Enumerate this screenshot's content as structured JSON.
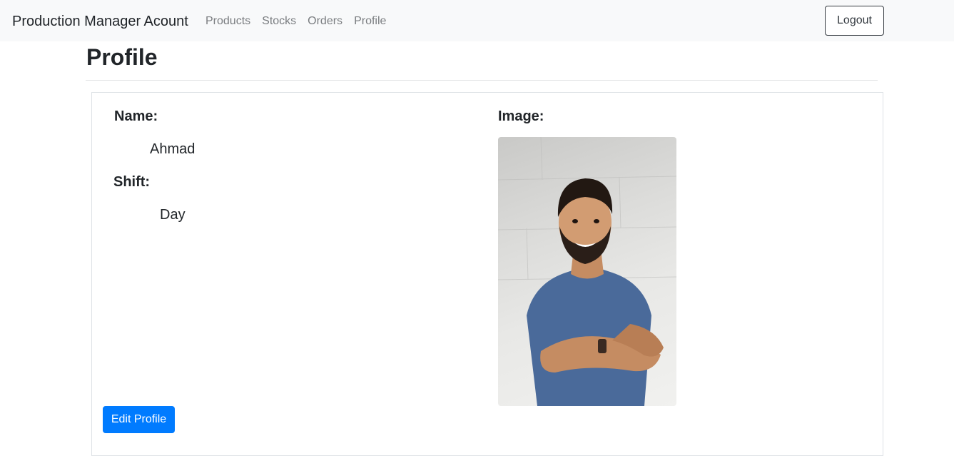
{
  "navbar": {
    "brand": "Production Manager Acount",
    "links": [
      "Products",
      "Stocks",
      "Orders",
      "Profile"
    ],
    "logout_label": "Logout"
  },
  "page": {
    "title": "Profile"
  },
  "profile": {
    "name_label": "Name:",
    "name_value": "Ahmad",
    "shift_label": "Shift:",
    "shift_value": "Day",
    "image_label": "Image:",
    "edit_label": "Edit Profile"
  },
  "colors": {
    "navbar_bg": "#f8f9fa",
    "primary": "#007bff",
    "nav_link": "#7a7d80"
  }
}
